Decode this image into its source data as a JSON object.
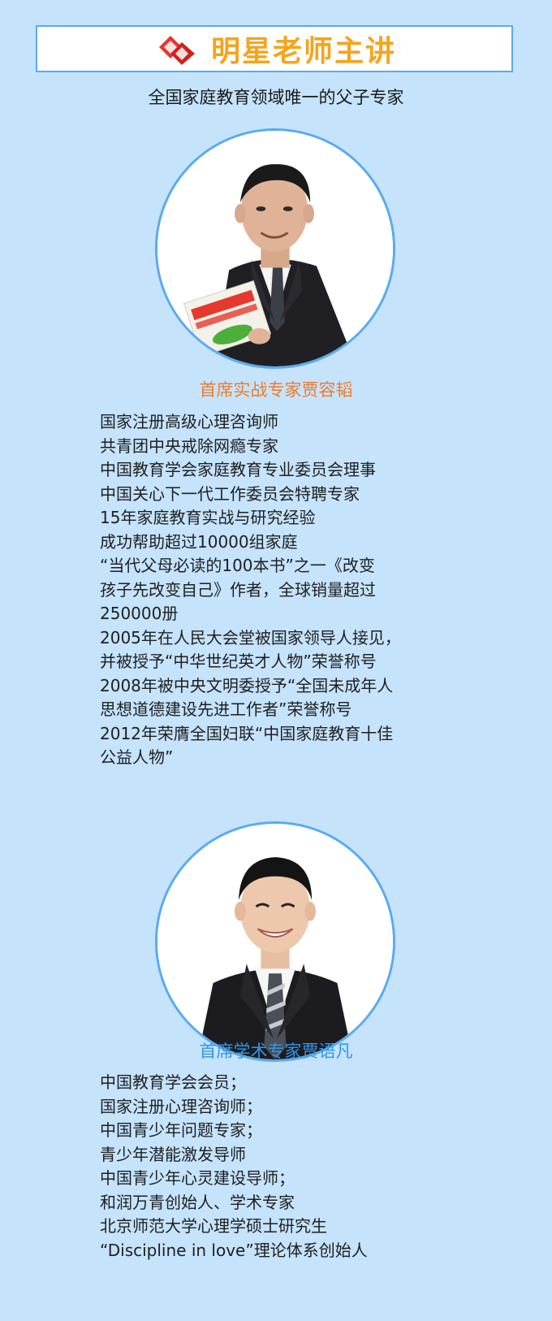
{
  "header": {
    "title": "明星老师主讲",
    "logo_icon": "red-double-chevron-icon",
    "accent_color": "#f5a41c",
    "border_color": "#5aaaf0"
  },
  "subtitle": "全国家庭教育领域唯一的父子专家",
  "experts": [
    {
      "name": "首席实战专家贾容韬",
      "name_color": "#f07a2a",
      "photo_icon": "man-in-suit-holding-book-portrait",
      "bio": [
        "国家注册高级心理咨询师",
        "共青团中央戒除网瘾专家",
        "中国教育学会家庭教育专业委员会理事",
        "中国关心下一代工作委员会特聘专家",
        "15年家庭教育实战与研究经验",
        "成功帮助超过10000组家庭",
        "“当代父母必读的100本书”之一《改变",
        "孩子先改变自己》作者，全球销量超过",
        "250000册",
        "2005年在人民大会堂被国家领导人接见，",
        "并被授予“中华世纪英才人物”荣誉称号",
        "2008年被中央文明委授予“全国未成年人",
        "思想道德建设先进工作者”荣誉称号",
        "2012年荣膺全国妇联“中国家庭教育十佳",
        "公益人物”"
      ]
    },
    {
      "name": "首席学术专家贾语凡",
      "name_color": "#2f97e8",
      "photo_icon": "young-man-in-suit-portrait",
      "bio": [
        "中国教育学会会员；",
        "国家注册心理咨询师；",
        "中国青少年问题专家；",
        "青少年潜能激发导师",
        "中国青少年心灵建设导师；",
        "和润万青创始人、学术专家",
        "北京师范大学心理学硕士研究生",
        "“Discipline in love”理论体系创始人"
      ]
    }
  ]
}
